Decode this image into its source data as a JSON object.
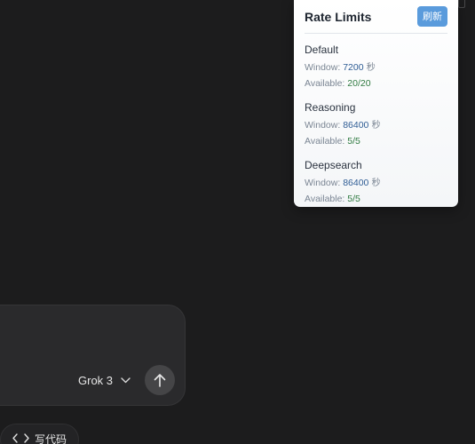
{
  "rate_limits": {
    "title": "Rate Limits",
    "refresh_label": "刷新",
    "groups": [
      {
        "name": "Default",
        "window_label": "Window: ",
        "window_value": "7200",
        "window_unit": " 秒",
        "available_label": "Available: ",
        "available_value": "20/20"
      },
      {
        "name": "Reasoning",
        "window_label": "Window: ",
        "window_value": "86400",
        "window_unit": " 秒",
        "available_label": "Available: ",
        "available_value": "5/5"
      },
      {
        "name": "Deepsearch",
        "window_label": "Window: ",
        "window_value": "86400",
        "window_unit": " 秒",
        "available_label": "Available: ",
        "available_value": "5/5"
      }
    ]
  },
  "composer": {
    "model_label": "Grok 3",
    "model_icon": "chevron-down-icon",
    "send_icon": "arrow-up-icon"
  },
  "quick_actions": {
    "write_code_label": "写代码",
    "write_code_icon": "code-icon"
  },
  "colors": {
    "background": "#1c1c1d",
    "refresh_button": "#5a9bdc",
    "window_value": "#2f5d95",
    "available_value": "#2f7a40"
  }
}
